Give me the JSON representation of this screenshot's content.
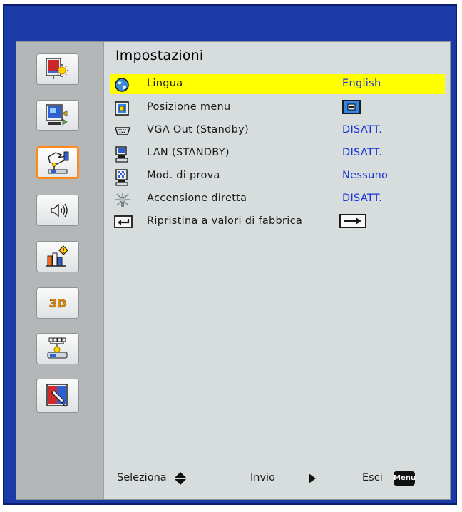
{
  "menu": {
    "title": "Impostazioni",
    "items": [
      {
        "label": "Lingua",
        "value": "English",
        "selected": true,
        "icon": "globe-icon"
      },
      {
        "label": "Posizione menu",
        "value": "",
        "icon": "menu-position-icon",
        "value_icon": "menu-position-box-icon"
      },
      {
        "label": "VGA Out (Standby)",
        "value": "DISATT.",
        "icon": "vga-port-icon"
      },
      {
        "label": "LAN (STANDBY)",
        "value": "DISATT.",
        "icon": "lan-icon"
      },
      {
        "label": "Mod. di prova",
        "value": "Nessuno",
        "icon": "test-pattern-icon"
      },
      {
        "label": "Accensione diretta",
        "value": "DISATT.",
        "icon": "power-spark-icon"
      },
      {
        "label": "Ripristina a valori di fabbrica",
        "value": "",
        "icon": "enter-key-icon",
        "value_icon": "right-arrow-box-icon"
      }
    ]
  },
  "sidebar": {
    "items": [
      {
        "name": "image-settings-icon",
        "active": false
      },
      {
        "name": "display-settings-icon",
        "active": false
      },
      {
        "name": "setup-icon",
        "active": true
      },
      {
        "name": "audio-icon",
        "active": false
      },
      {
        "name": "options-icon",
        "active": false
      },
      {
        "name": "3d-icon",
        "active": false,
        "text": "3D"
      },
      {
        "name": "network-icon",
        "active": false
      },
      {
        "name": "interactive-icon",
        "active": false
      }
    ]
  },
  "footer": {
    "select_label": "Seleziona",
    "enter_label": "Invio",
    "exit_label": "Esci",
    "menu_key": "Menu"
  },
  "colors": {
    "frame_border": "#1a3aa8",
    "highlight": "#ffff00",
    "value_text": "#1a33d6",
    "active_tab_border": "#ff8a1c"
  }
}
